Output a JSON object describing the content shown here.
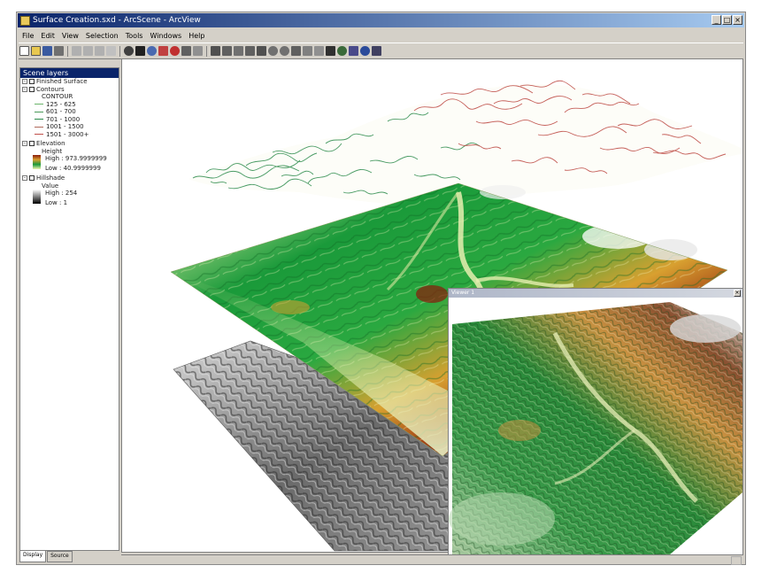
{
  "window": {
    "title": "Surface Creation.sxd - ArcScene - ArcView",
    "controls": [
      "_",
      "□",
      "×"
    ]
  },
  "menu": [
    "File",
    "Edit",
    "View",
    "Selection",
    "Tools",
    "Windows",
    "Help"
  ],
  "toc": {
    "header": "Scene layers",
    "layers": [
      {
        "name": "Finished Surface",
        "type": "group"
      },
      {
        "name": "Contours",
        "field": "CONTOUR",
        "classes": [
          "125 - 625",
          "601 - 700",
          "701 - 1000",
          "1001 - 1500",
          "1501 - 3000+"
        ]
      },
      {
        "name": "Elevation",
        "field": "Height",
        "high": "High : 973.9999999",
        "low": "Low : 40.9999999"
      },
      {
        "name": "Hillshade",
        "field": "Value",
        "high": "High : 254",
        "low": "Low : 1"
      }
    ]
  },
  "tabs": [
    "Display",
    "Source"
  ],
  "inset": {
    "title": "Viewer 1",
    "close": "×"
  },
  "colors": {
    "title_bar": "#0a246a",
    "high_elevation": "#8b1a0a",
    "mid_elevation": "#d8a030",
    "low_elevation": "#1a9a3a",
    "base_elevation": "#f0f4b0",
    "contour_green": "#2a8a4a",
    "contour_red": "#c0504a"
  }
}
